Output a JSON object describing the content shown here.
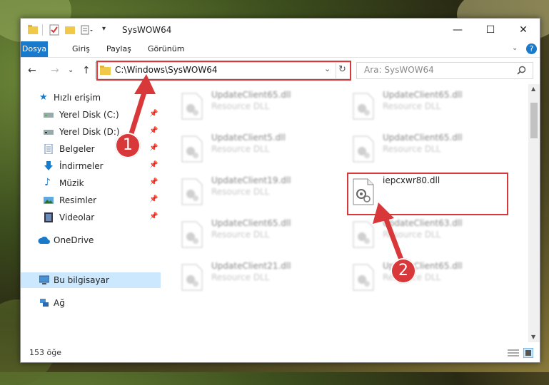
{
  "window": {
    "title": "SysWOW64",
    "controls": {
      "minimize": "—",
      "maximize": "☐",
      "close": "✕"
    }
  },
  "ribbon": {
    "tabs": [
      "Dosya",
      "Giriş",
      "Paylaş",
      "Görünüm"
    ],
    "help": "?"
  },
  "address": {
    "path": "C:\\Windows\\SysWOW64",
    "search_placeholder": "Ara: SysWOW64"
  },
  "nav": {
    "items": [
      {
        "label": "Hızlı erişim",
        "icon": "star-icon"
      },
      {
        "label": "Yerel Disk (C:)",
        "icon": "drive-icon",
        "pinned": true
      },
      {
        "label": "Yerel Disk (D:)",
        "icon": "drive-icon",
        "pinned": true
      },
      {
        "label": "Belgeler",
        "icon": "document-icon",
        "pinned": true
      },
      {
        "label": "İndirmeler",
        "icon": "download-icon",
        "pinned": true
      },
      {
        "label": "Müzik",
        "icon": "music-icon",
        "pinned": true
      },
      {
        "label": "Resimler",
        "icon": "pictures-icon",
        "pinned": true
      },
      {
        "label": "Videolar",
        "icon": "video-icon",
        "pinned": true
      },
      {
        "label": "OneDrive",
        "icon": "cloud-icon"
      },
      {
        "label": "Bu bilgisayar",
        "icon": "computer-icon",
        "selected": true
      },
      {
        "label": "Ağ",
        "icon": "network-icon"
      }
    ]
  },
  "files": {
    "left": [
      {
        "name": "UpdateClient65.dll",
        "desc": "Resource DLL"
      },
      {
        "name": "UpdateClient5.dll",
        "desc": "Resource DLL"
      },
      {
        "name": "UpdateClient19.dll",
        "desc": "Resource DLL"
      },
      {
        "name": "UpdateClient65.dll",
        "desc": "Resource DLL"
      },
      {
        "name": "UpdateClient21.dll",
        "desc": "Resource DLL"
      }
    ],
    "right": [
      {
        "name": "UpdateClient65.dll",
        "desc": "Resource DLL"
      },
      {
        "name": "UpdateClient65.dll",
        "desc": "Resource DLL"
      },
      {
        "name": "iepcxwr80.dll",
        "desc": ""
      },
      {
        "name": "UpdateClient63.dll",
        "desc": "Resource DLL"
      },
      {
        "name": "UpdateClient65.dll",
        "desc": "Resource DLL"
      }
    ]
  },
  "status": {
    "count": "153 öğe"
  },
  "annotations": {
    "step1": "1",
    "step2": "2"
  },
  "colors": {
    "accent": "#1979ca",
    "highlight": "#d9383a",
    "selected": "#cce8ff"
  }
}
